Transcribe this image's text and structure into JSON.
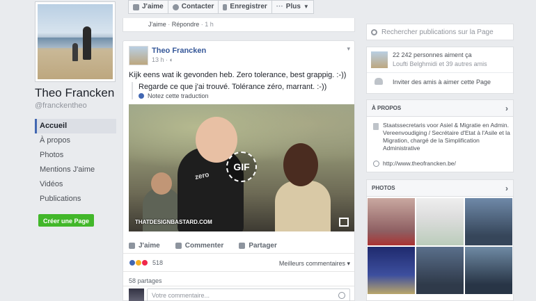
{
  "profile": {
    "name": "Theo Francken",
    "handle": "@franckentheo"
  },
  "left_nav": {
    "items": [
      {
        "label": "Accueil",
        "active": true
      },
      {
        "label": "À propos"
      },
      {
        "label": "Photos"
      },
      {
        "label": "Mentions J'aime"
      },
      {
        "label": "Vidéos"
      },
      {
        "label": "Publications"
      }
    ],
    "create_page_label": "Créer une Page"
  },
  "action_bar": {
    "like_label": "J'aime",
    "contact_label": "Contacter",
    "save_label": "Enregistrer",
    "more_label": "Plus"
  },
  "previous_post": {
    "like_link": "J'aime",
    "separator": " · ",
    "reply_link": "Répondre",
    "age": " · 1 h"
  },
  "post": {
    "author": "Theo Francken",
    "time": "13 h · ",
    "text": "Kijk eens wat ik gevonden heb. Zero tolerance, best grappig. :-))",
    "translation": "Regarde ce que j'ai trouvé. Tolérance zéro, marrant. :-))",
    "rate_translation": "Notez cette traduction",
    "media": {
      "gif_label": "GIF",
      "shirt_text": "zero",
      "watermark": "THATDESIGNBASTARD.COM"
    },
    "actions": {
      "like": "J'aime",
      "comment": "Commenter",
      "share": "Partager"
    },
    "reactions_count": "518",
    "best_comments": "Meilleurs commentaires",
    "shares": "58 partages",
    "comment_placeholder": "Votre commentaire..."
  },
  "right": {
    "search_placeholder": "Rechercher publications sur la Page",
    "likes_count": "22 242 personnes aiment ça",
    "friends_like": "Loufti Belghmidi et 39 autres amis",
    "invite": "Inviter des amis à aimer cette Page",
    "about_title": "À PROPOS",
    "about_desc": "Staatssecretaris voor Asiel & Migratie en Admin. Vereenvoudiging / Secrétaire d'Etat à l'Asile et la Migration, chargé de la Simplification Administrative",
    "website": "http://www.theofrancken.be/",
    "photos_title": "PHOTOS"
  },
  "colors": {
    "brand_blue": "#4267b2",
    "link_blue": "#365899",
    "create_green": "#42b72a",
    "background": "#e9ebee"
  }
}
